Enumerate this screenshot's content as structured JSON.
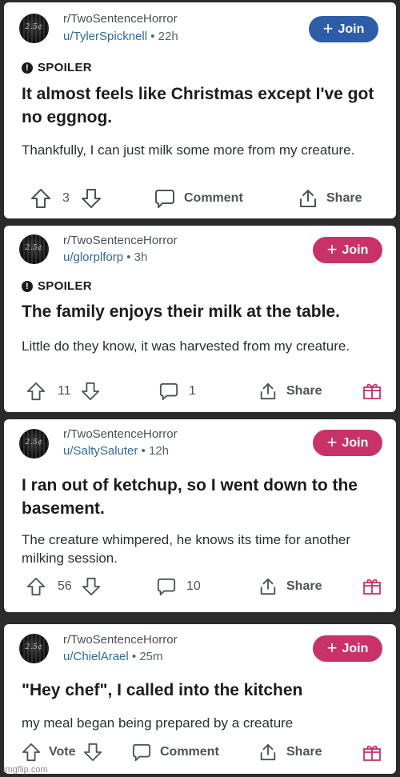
{
  "posts": [
    {
      "subreddit": "r/TwoSentenceHorror",
      "user": "u/TylerSpicknell",
      "age": "22h",
      "join_label": "Join",
      "join_color": "#2e5ca8",
      "spoiler": "SPOILER",
      "title": "It almost feels like Christmas except I've got no eggnog.",
      "body": "Thankfully, I can just milk some more from my creature.",
      "votes": "3",
      "comments": "Comment",
      "share": "Share",
      "avatar_text": "2.5¢"
    },
    {
      "subreddit": "r/TwoSentenceHorror",
      "user": "u/glorplforp",
      "age": "3h",
      "join_label": "Join",
      "join_color": "#c93268",
      "spoiler": "SPOILER",
      "title": "The family enjoys their milk at the table.",
      "body": "Little do they know, it was harvested from  my creature.",
      "votes": "11",
      "comments": "1",
      "share": "Share",
      "avatar_text": "2.5¢"
    },
    {
      "subreddit": "r/TwoSentenceHorror",
      "user": "u/SaltySaluter",
      "age": "12h",
      "join_label": "Join",
      "join_color": "#c93268",
      "title": "I ran out of ketchup, so I went down to the basement.",
      "body": "The creature whimpered, he knows its time for another milking session.",
      "votes": "56",
      "comments": "10",
      "share": "Share",
      "avatar_text": "2.5¢"
    },
    {
      "subreddit": "r/TwoSentenceHorror",
      "user": "u/ChielArael",
      "age": "25m",
      "join_label": "Join",
      "join_color": "#c93268",
      "title": "\"Hey chef\", I called into the kitchen",
      "body": "my meal began being prepared by a creature",
      "votes": "Vote",
      "comments": "Comment",
      "share": "Share",
      "avatar_text": "2.5¢"
    }
  ],
  "watermark": "imgflip.com",
  "icons": {
    "upvote": "arrow-up-icon",
    "downvote": "arrow-down-icon",
    "comment": "comment-bubble-icon",
    "share": "share-icon",
    "award": "gift-award-icon",
    "spoiler": "exclamation-circle-icon"
  }
}
